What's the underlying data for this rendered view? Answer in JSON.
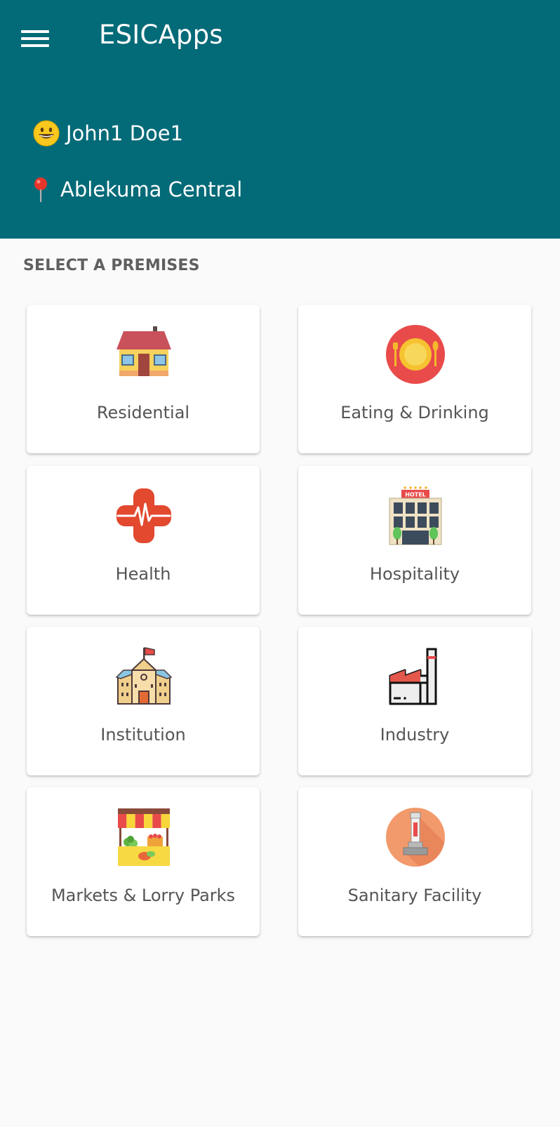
{
  "app": {
    "title": "ESICApps",
    "icons": {
      "menu": "hamburger-menu-icon"
    }
  },
  "user": {
    "name": "John1 Doe1",
    "icon": "smiley-face-icon"
  },
  "location": {
    "name": "Ablekuma Central",
    "icon": "map-pin-icon"
  },
  "premises": {
    "section_title": "SELECT A PREMISES",
    "items": [
      {
        "label": "Residential",
        "icon": "house-icon"
      },
      {
        "label": "Eating & Drinking",
        "icon": "plate-cutlery-icon"
      },
      {
        "label": "Health",
        "icon": "medical-cross-icon"
      },
      {
        "label": "Hospitality",
        "icon": "hotel-icon",
        "icon_text": "HOTEL"
      },
      {
        "label": "Institution",
        "icon": "school-building-icon"
      },
      {
        "label": "Industry",
        "icon": "factory-icon"
      },
      {
        "label": "Markets & Lorry Parks",
        "icon": "market-stall-icon"
      },
      {
        "label": "Sanitary Facility",
        "icon": "sanitary-facility-icon"
      }
    ]
  },
  "colors": {
    "header_bg": "#036a78",
    "page_bg": "#fafafa",
    "card_bg": "#ffffff",
    "label_text": "#555555",
    "section_title_text": "#5f5f5f"
  }
}
